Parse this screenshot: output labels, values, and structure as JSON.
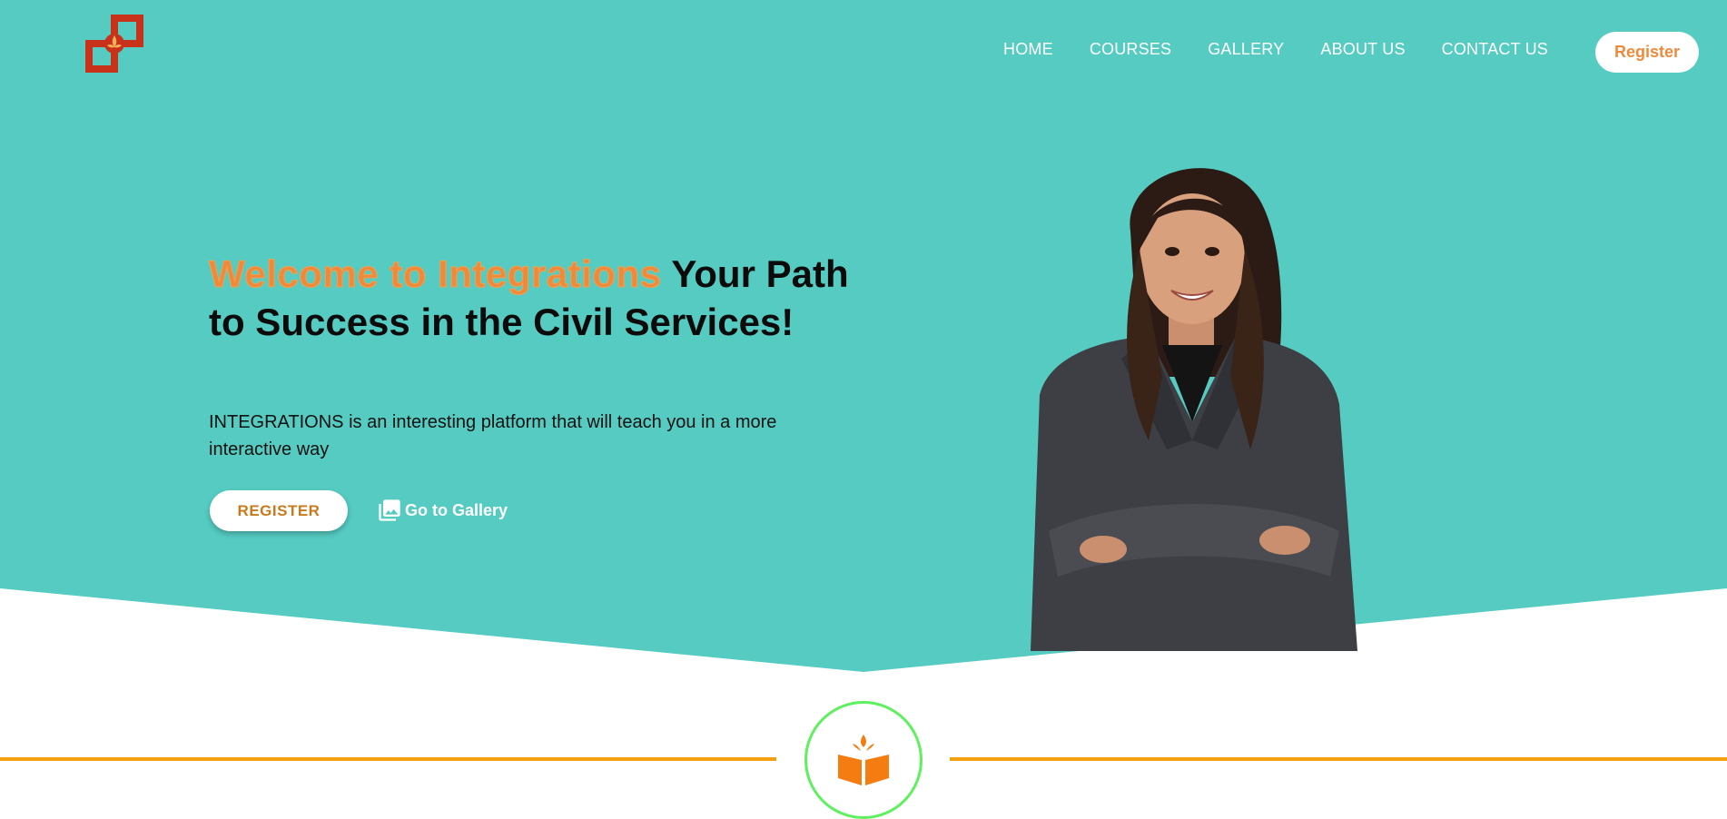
{
  "brand": {
    "logo_icon": "swastika-logo-icon"
  },
  "nav": {
    "items": [
      {
        "label": "HOME"
      },
      {
        "label": "COURSES"
      },
      {
        "label": "GALLERY"
      },
      {
        "label": "ABOUT US"
      },
      {
        "label": "CONTACT US"
      }
    ],
    "register_label": "Register"
  },
  "hero": {
    "headline_accent": "Welcome to Integrations",
    "headline_rest": " Your Path to Success in the Civil Services!",
    "subtitle": "INTEGRATIONS is an interesting platform that will teach you in a more interactive way",
    "register_button": "REGISTER",
    "gallery_link": "Go to Gallery",
    "gallery_icon": "photo-library-icon",
    "image": "woman-in-blazer-portrait"
  },
  "section_divider": {
    "icon": "open-book-icon"
  },
  "colors": {
    "hero_bg": "#55cbc1",
    "accent_orange": "#ef8a3c",
    "divider_orange": "#f3a012",
    "emblem_ring": "#5ef05e"
  }
}
